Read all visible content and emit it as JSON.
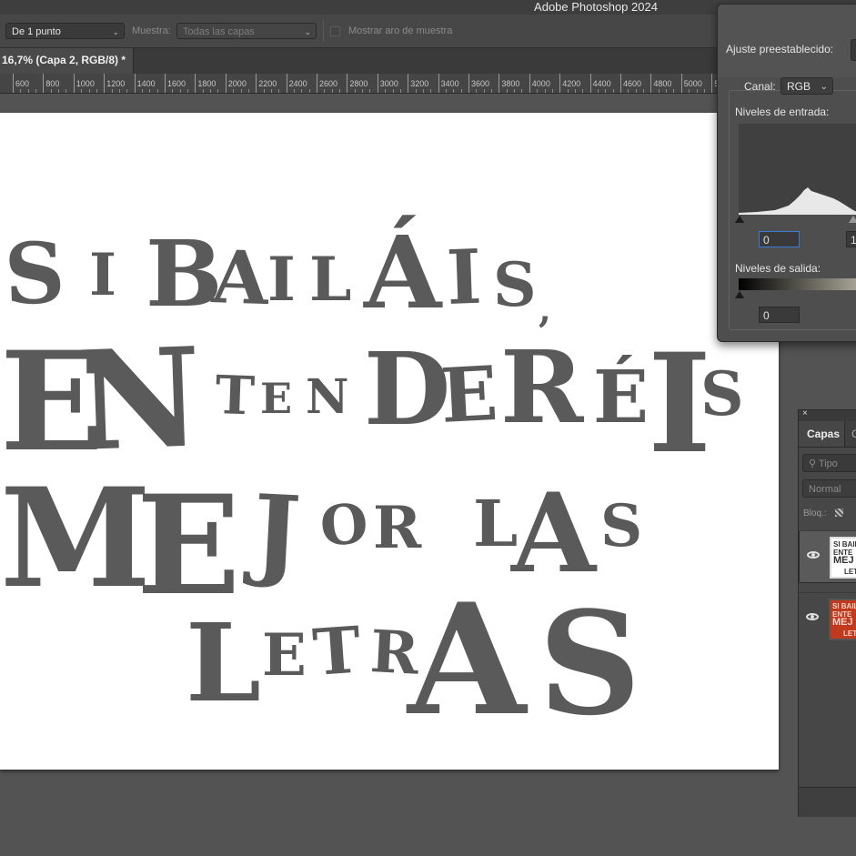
{
  "app": {
    "title": "Adobe Photoshop 2024"
  },
  "options_bar": {
    "sample_size": "De 1 punto",
    "sample_label": "Muestra:",
    "sample_value": "Todas las capas",
    "show_ring_label": "Mostrar aro de muestra"
  },
  "document": {
    "tab_title": "16,7% (Capa 2, RGB/8) *"
  },
  "ruler": {
    "labels": [
      "600",
      "800",
      "1000",
      "1200",
      "1400",
      "1600",
      "1800",
      "2000",
      "2200",
      "2400",
      "2600",
      "2800",
      "3000",
      "3200",
      "3400",
      "3600",
      "3800",
      "4000",
      "4200",
      "4400",
      "4600",
      "4800",
      "5000",
      "5"
    ]
  },
  "artwork": {
    "line1": [
      "S",
      "I",
      "B",
      "A",
      "I",
      "L",
      "Á",
      "I",
      "S",
      ","
    ],
    "line2": [
      "E",
      "N",
      "T",
      "E",
      "N",
      "D",
      "E",
      "R",
      "É",
      "I",
      "S"
    ],
    "line3": [
      "M",
      "E",
      "J",
      "O",
      "R",
      "L",
      "A",
      "S"
    ],
    "line4": [
      "L",
      "E",
      "T",
      "R",
      "A",
      "S"
    ]
  },
  "levels_panel": {
    "preset_label": "Ajuste preestablecido:",
    "channel_label": "Canal:",
    "channel_value": "RGB",
    "input_label": "Niveles de entrada:",
    "input_black": "0",
    "input_mid": "1,",
    "output_label": "Niveles de salida:",
    "output_black": "0"
  },
  "layers_panel": {
    "close": "×",
    "tab_layers": "Capas",
    "tab_other": "C",
    "search_placeholder": "Tipo",
    "blend_mode": "Normal",
    "lock_label": "Bloq.:",
    "thumb_text": [
      "SI BAIL",
      "ENTE",
      "MEJ",
      "LET"
    ]
  },
  "colors": {
    "thumb_red": "#c23a1e",
    "accent": "#3a7bd5"
  },
  "icons": {
    "eye": "eye-icon",
    "search": "search-icon",
    "chevron": "chevron-down-icon",
    "lock": "lock-transparency-icon"
  }
}
